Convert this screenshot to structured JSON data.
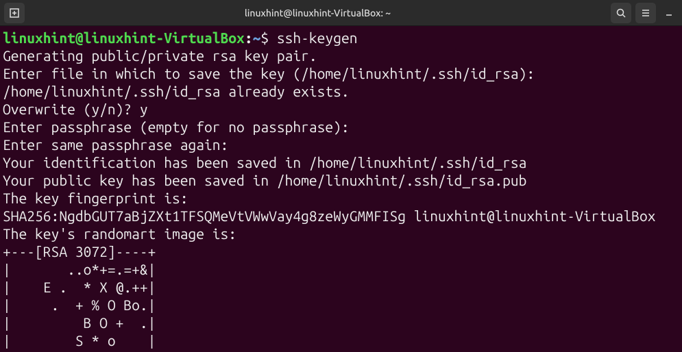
{
  "titlebar": {
    "title": "linuxhint@linuxhint-VirtualBox: ~"
  },
  "prompt": {
    "user_host": "linuxhint@linuxhint-VirtualBox",
    "path": "~",
    "command": "ssh-keygen"
  },
  "output": {
    "lines": [
      "Generating public/private rsa key pair.",
      "Enter file in which to save the key (/home/linuxhint/.ssh/id_rsa):",
      "/home/linuxhint/.ssh/id_rsa already exists.",
      "Overwrite (y/n)? y",
      "Enter passphrase (empty for no passphrase):",
      "Enter same passphrase again:",
      "Your identification has been saved in /home/linuxhint/.ssh/id_rsa",
      "Your public key has been saved in /home/linuxhint/.ssh/id_rsa.pub",
      "The key fingerprint is:",
      "SHA256:NgdbGUT7aBjZXt1TFSQMeVtVWwVay4g8zeWyGMMFISg linuxhint@linuxhint-VirtualBox",
      "The key's randomart image is:",
      "+---[RSA 3072]----+",
      "|       ..o*+=.=+&|",
      "|    E .  * X @.++|",
      "|     .  + % O Bo.|",
      "|         B O +  .|",
      "|        S * o    |"
    ]
  }
}
